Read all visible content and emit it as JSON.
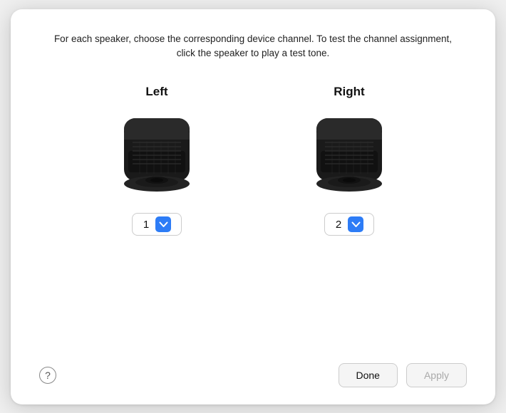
{
  "dialog": {
    "description": "For each speaker, choose the corresponding device channel. To test the channel assignment, click the speaker to play a test tone.",
    "left_label": "Left",
    "right_label": "Right",
    "left_channel_value": "1",
    "right_channel_value": "2",
    "help_label": "?",
    "done_label": "Done",
    "apply_label": "Apply",
    "colors": {
      "dropdown_btn": "#2d7cf6",
      "apply_disabled": "#aaa"
    }
  }
}
